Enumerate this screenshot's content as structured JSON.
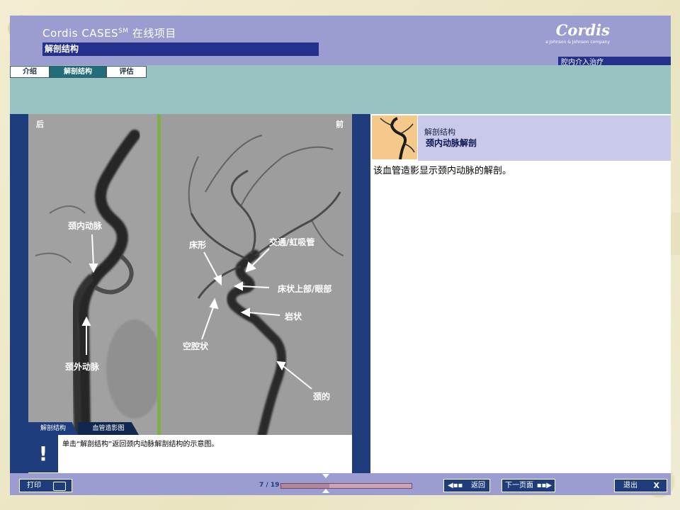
{
  "header": {
    "title": "Cordis CASES",
    "title_sup": "SM",
    "title_suffix": "在线项目",
    "section": "解剖结构",
    "logo": "Cordis",
    "logo_sub": "a Johnson & Johnson company",
    "therapy": "腔内介入治疗"
  },
  "tabs": [
    {
      "label": "介绍",
      "active": false
    },
    {
      "label": "解剖结构",
      "active": true
    },
    {
      "label": "评估",
      "active": false
    }
  ],
  "image": {
    "orientation_left": "后",
    "orientation_right": "前",
    "labels": {
      "ica": "颈内动脉",
      "eca": "颈外动脉",
      "clinoid": "床形",
      "communicating": "交通/虹吸管",
      "supraclinoid": "床状上部/眼部",
      "petrous": "岩状",
      "cavernous": "空腔状",
      "cervical": "颈的"
    },
    "tab_anatomy": "解剖结构",
    "tab_angiogram": "血管造影图"
  },
  "caption": "单击“解剖结构”返回颈内动脉解剖结构的示意图。",
  "alert_glyph": "!",
  "info": {
    "small": "解剖结构",
    "big": "颈内动脉解剖",
    "description": "该血管造影显示颈内动脉的解剖。"
  },
  "footer": {
    "print": "打印",
    "page": "7 / 19",
    "progress": 0.368,
    "back": "返回",
    "next": "下一页面",
    "exit": "退出",
    "exit_x": "X"
  },
  "colors": {
    "navy": "#1f3d7d",
    "header": "#9b9cd0",
    "teal": "#99c2c2"
  }
}
